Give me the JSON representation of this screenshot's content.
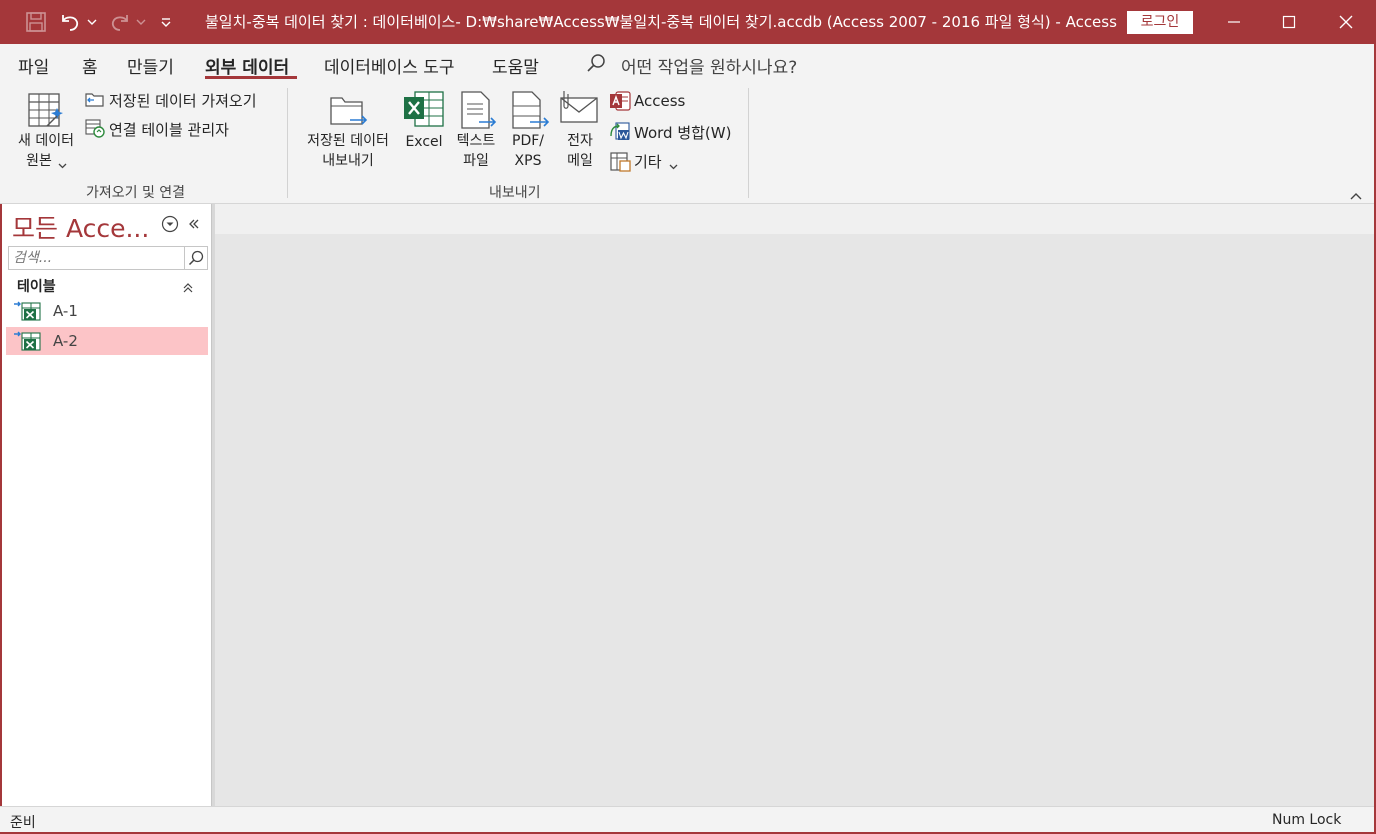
{
  "window": {
    "title": "불일치-중복 데이터 찾기 : 데이터베이스- D:₩share₩Access₩불일치-중복 데이터 찾기.accdb (Access 2007 - 2016 파일 형식)  -  Access",
    "login_label": "로그인"
  },
  "tabs": [
    "파일",
    "홈",
    "만들기",
    "외부 데이터",
    "데이터베이스 도구",
    "도움말"
  ],
  "tell_me": "어떤 작업을 원하시나요?",
  "ribbon": {
    "import_group": {
      "label": "가져오기 및 연결",
      "new_source_line1": "새 데이터",
      "new_source_line2": "원본",
      "saved_imports": "저장된 데이터 가져오기",
      "linked_table_manager": "연결 테이블 관리자"
    },
    "export_group": {
      "label": "내보내기",
      "saved_exports_line1": "저장된 데이터",
      "saved_exports_line2": "내보내기",
      "excel": "Excel",
      "text_line1": "텍스트",
      "text_line2": "파일",
      "pdf_line1": "PDF/",
      "pdf_line2": "XPS",
      "email_line1": "전자",
      "email_line2": "메일",
      "access": "Access",
      "word_merge": "Word 병합(W)",
      "more": "기타"
    }
  },
  "nav": {
    "title": "모든 Acce...",
    "search_placeholder": "검색...",
    "group_label": "테이블",
    "items": [
      {
        "label": "A-1",
        "selected": false
      },
      {
        "label": "A-2",
        "selected": true
      }
    ]
  },
  "status": {
    "left": "준비",
    "right": "Num Lock"
  },
  "colors": {
    "accent": "#a4373a",
    "selected_row": "#fcc4c7",
    "ribbon_bg": "#f3f3f3",
    "workspace_bg": "#e6e6e6"
  }
}
